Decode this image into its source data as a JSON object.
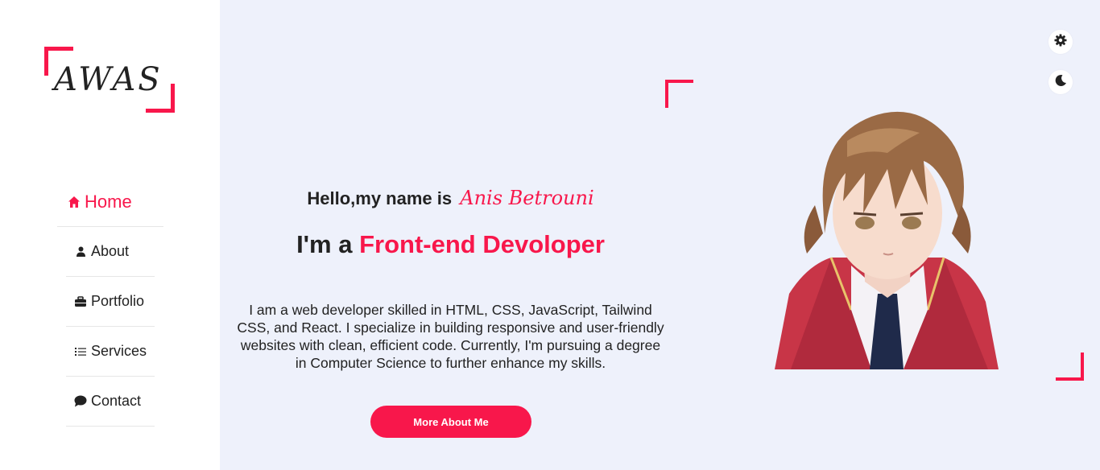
{
  "logo": {
    "text": "AWAS"
  },
  "nav": {
    "items": [
      {
        "label": "Home",
        "icon": "home-icon",
        "active": true
      },
      {
        "label": "About",
        "icon": "user-icon"
      },
      {
        "label": "Portfolio",
        "icon": "briefcase-icon"
      },
      {
        "label": "Services",
        "icon": "list-icon"
      },
      {
        "label": "Contact",
        "icon": "chat-bubble-icon"
      }
    ]
  },
  "hero": {
    "greeting": "Hello,my name is",
    "name": "Anis Betrouni",
    "role_prefix": "I'm a",
    "role_highlight": "Front-end Devoloper",
    "description": "I am a web developer skilled in HTML, CSS, JavaScript, Tailwind CSS, and React. I specialize in building responsive and user-friendly websites with clean, efficient code. Currently, I'm pursuing a degree in Computer Science to further enhance my skills.",
    "cta_label": "More About Me"
  },
  "controls": {
    "settings_icon": "gear-icon",
    "theme_icon": "moon-icon"
  },
  "colors": {
    "accent": "#f8174b",
    "background": "#eef1fb",
    "sidebar": "#ffffff",
    "text": "#222222"
  }
}
